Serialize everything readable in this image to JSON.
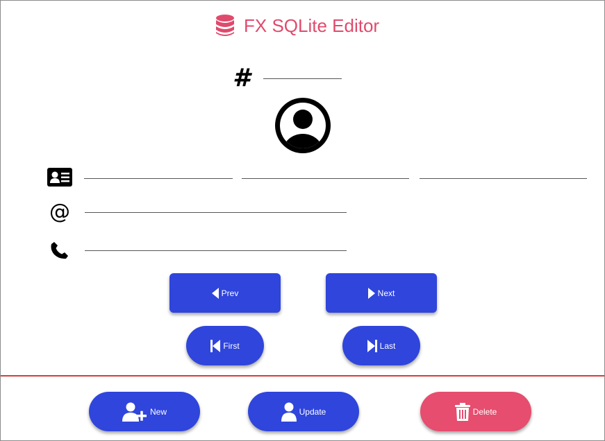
{
  "app": {
    "title": "FX SQLite Editor",
    "db_icon": "database-icon",
    "accent_color": "#e04a6c"
  },
  "form": {
    "id_icon": "#",
    "id_value": "",
    "avatar_icon": "user-circle-icon",
    "name_icon": "id-card-icon",
    "first_name": "",
    "middle_name": "",
    "last_name": "",
    "email_icon": "@",
    "email": "",
    "phone_icon": "phone-icon",
    "phone": ""
  },
  "navigation": {
    "prev_label": "Prev",
    "next_label": "Next",
    "first_label": "First",
    "last_label": "Last",
    "button_color": "#2f45dc"
  },
  "actions": {
    "new_label": "New",
    "update_label": "Update",
    "delete_label": "Delete",
    "delete_color": "#e64d6e",
    "divider_color": "#d83a3a"
  }
}
